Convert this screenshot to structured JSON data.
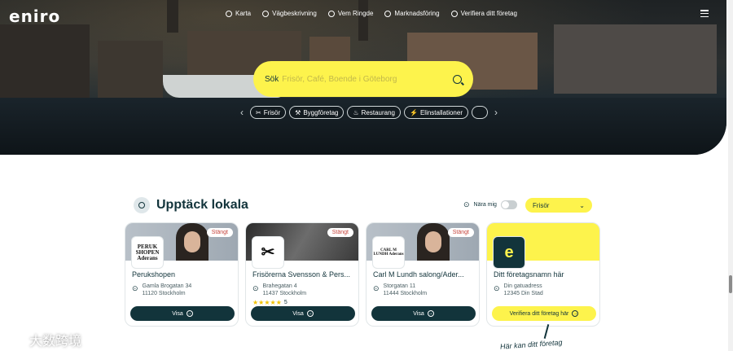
{
  "header": {
    "logo": "eniro",
    "nav": [
      {
        "label": "Karta",
        "icon": "map-icon"
      },
      {
        "label": "Vägbeskrivning",
        "icon": "route-icon"
      },
      {
        "label": "Vem Ringde",
        "icon": "phone-icon"
      },
      {
        "label": "Marknadsföring",
        "icon": "sparkle-icon"
      },
      {
        "label": "Verifiera ditt företag",
        "icon": "check-circle-icon"
      }
    ]
  },
  "search": {
    "label": "Sök",
    "placeholder": "Frisör, Café, Boende i Göteborg"
  },
  "categories": [
    {
      "label": "Frisör",
      "icon": "haircut-icon"
    },
    {
      "label": "Byggföretag",
      "icon": "tools-icon"
    },
    {
      "label": "Restaurang",
      "icon": "chef-hat-icon"
    },
    {
      "label": "Elinstallationer",
      "icon": "plug-icon"
    }
  ],
  "section": {
    "title": "Upptäck lokala",
    "near_me": "Nära mig",
    "filter_value": "Frisör"
  },
  "cards": [
    {
      "name": "Perukshopen",
      "street": "Gamla Brogatan 34",
      "city": "11120 Stockholm",
      "badge": "Stängt",
      "thumb": "PERUK SHOPEN Aderans",
      "button": "Visa"
    },
    {
      "name": "Frisörerna Svensson & Pers...",
      "street": "Brahegatan 4",
      "city": "11437 Stockholm",
      "badge": "Stängt",
      "rating": "5",
      "button": "Visa"
    },
    {
      "name": "Carl M Lundh salong/Ader...",
      "street": "Storgatan 11",
      "city": "11444 Stockholm",
      "badge": "Stängt",
      "thumb": "CARL M LUNDH Aderans",
      "button": "Visa"
    },
    {
      "name": "Ditt företagsnamn här",
      "street": "Din gatuadress",
      "city": "12345 Din Stad",
      "thumb": "e",
      "button": "Verifiera ditt företag här"
    }
  ],
  "annotation": "Här kan ditt företag",
  "watermark": "大数跨境",
  "colors": {
    "accent": "#fdf34c",
    "primary": "#12343b",
    "closed": "#c6443c"
  }
}
